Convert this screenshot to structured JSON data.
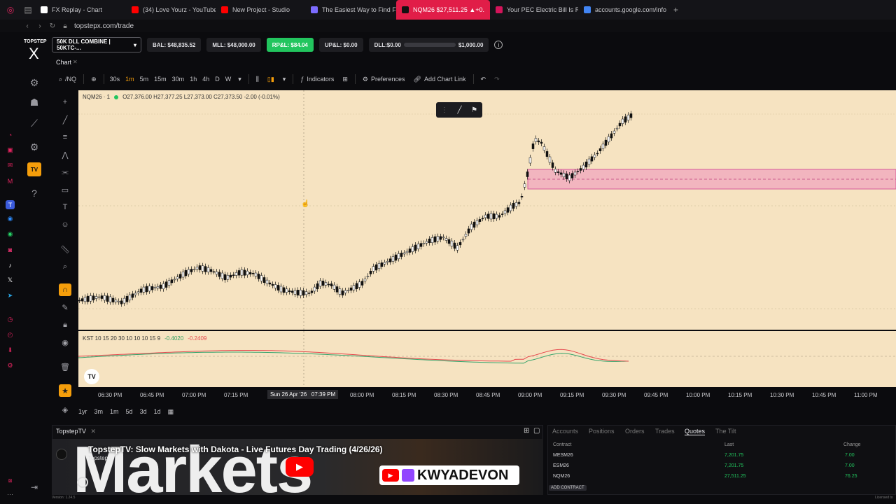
{
  "browser": {
    "tabs": [
      {
        "label": "FX Replay - Chart",
        "fav_color": "#ffffff"
      },
      {
        "label": "(34) Love Yourz - YouTube",
        "fav_color": "#ff0000"
      },
      {
        "label": "New Project - Studio",
        "fav_color": "#ff0000"
      },
      {
        "label": "The Easiest Way to Find F",
        "fav_color": "#7c6cff"
      },
      {
        "label": "NQM26 $27,511.25 ▲+0.",
        "fav_color": "#111111"
      },
      {
        "label": "Your PEC Electric Bill Is R",
        "fav_color": "#d4145a"
      },
      {
        "label": "accounts.google.com/info",
        "fav_color": "#4285f4"
      }
    ],
    "new_tab": "+",
    "url": "topstepx.com/trade"
  },
  "brand": {
    "top": "TOPSTEP",
    "mark": "X"
  },
  "account": {
    "selector": "50K DLL COMBINE | 50KTC-...",
    "bal": "BAL: $48,835.52",
    "mll": "MLL: $48,000.00",
    "rpl": "RP&L: $84.04",
    "upl": "UP&L: $0.00",
    "dll": "DLL:$0.00",
    "dll_max": "$1,000.00",
    "dll_progress": 0.0
  },
  "chart_panel": {
    "label": "Chart",
    "symbol_search": "/NQ",
    "timeframes": [
      "30s",
      "1m",
      "5m",
      "15m",
      "30m",
      "1h",
      "4h",
      "D",
      "W"
    ],
    "active_timeframe": "1m",
    "indicators": "Indicators",
    "preferences": "Preferences",
    "add_chart_link": "Add Chart Link",
    "legend_symbol": "NQM26 · 1",
    "legend_ohlc": "O27,376.00  H27,377.25  L27,373.00  C27,373.50  -2.00 (-0.01%)",
    "indicator_legend": "KST 10 15 20 30 10 10 10 15 9",
    "indicator_v1": "-0.4020",
    "indicator_v2": "-0.2409",
    "time_ticks": [
      "06:30 PM",
      "06:45 PM",
      "07:00 PM",
      "07:15 PM",
      "08:00 PM",
      "08:15 PM",
      "08:30 PM",
      "08:45 PM",
      "09:00 PM",
      "09:15 PM",
      "09:30 PM",
      "09:45 PM",
      "10:00 PM",
      "10:15 PM",
      "10:30 PM",
      "10:45 PM",
      "11:00 PM"
    ],
    "cursor_time": "Sun 26 Apr '26   07:39 PM",
    "ranges": [
      "1yr",
      "3m",
      "1m",
      "5d",
      "3d",
      "1d"
    ],
    "bg_color": "#f6e3c1",
    "zone_color": "#ee8fbe"
  },
  "tv_panel": {
    "title": "TopstepTV",
    "video_title": "TopstepTV: Slow Markets with Dakota - Live Futures Day Trading (4/26/26)",
    "channel": "Topstep",
    "big_text": "Markets",
    "overlay": "KWYADEVON"
  },
  "quotes_panel": {
    "tabs": [
      "Accounts",
      "Positions",
      "Orders",
      "Trades",
      "Quotes",
      "The Tilt"
    ],
    "active_tab": "Quotes",
    "headers": {
      "contract": "Contract",
      "last": "Last",
      "change": "Change"
    },
    "rows": [
      {
        "contract": "MESM26",
        "last": "7,201.75",
        "change": "7.00"
      },
      {
        "contract": "ESM26",
        "last": "7,201.75",
        "change": "7.00"
      },
      {
        "contract": "NQM26",
        "last": "27,511.25",
        "change": "76.25"
      }
    ],
    "add_contract": "ADD CONTRACT"
  },
  "footer": {
    "version": "Version: 1.24.5",
    "license": "Licensed to"
  }
}
